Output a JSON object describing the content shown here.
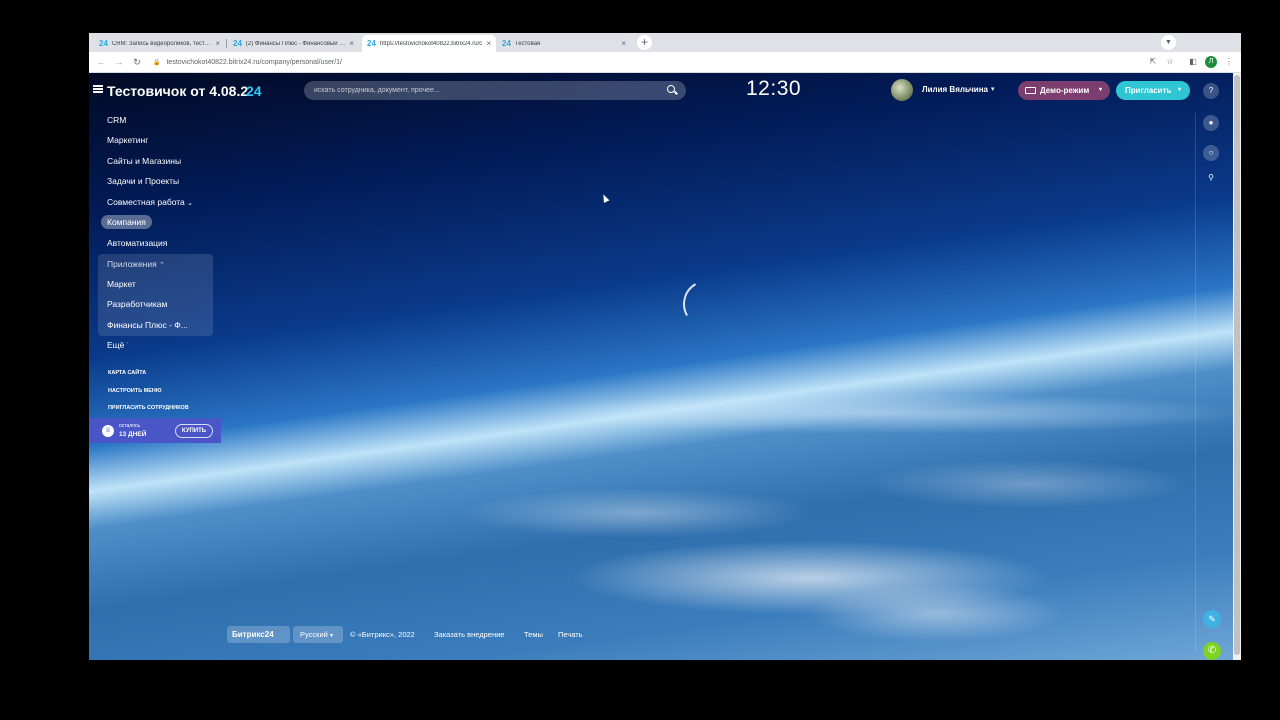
{
  "browser": {
    "tabs": [
      {
        "favicon": "24",
        "title": "CRM: Запись видеороликов, тестир"
      },
      {
        "favicon": "24",
        "title": "(2) Финансы Плюс - Финансовый и у"
      },
      {
        "favicon": "24",
        "title": "https://testovichokot40822.bitrix24.ru/c"
      },
      {
        "favicon": "24",
        "title": "Тестовая"
      }
    ],
    "url": "testovichokot40822.bitrix24.ru/company/personal/user/1/",
    "profile_initial": "Л",
    "new_tab": "+",
    "tab_close": "×"
  },
  "header": {
    "portal_title": "Тестовичок от 4.08.2",
    "logo_suffix": "24",
    "search_placeholder": "искать сотрудника, документ, прочее...",
    "clock": "12:30",
    "user_name": "Лилия Вяльчина",
    "demo_label": "Демо-режим",
    "invite_label": "Пригласить"
  },
  "menu": {
    "items": [
      {
        "label": "CRM"
      },
      {
        "label": "Маркетинг"
      },
      {
        "label": "Сайты и Магазины"
      },
      {
        "label": "Задачи и Проекты"
      },
      {
        "label": "Совместная работа"
      },
      {
        "label": "Компания"
      },
      {
        "label": "Автоматизация"
      },
      {
        "label": "Приложения"
      },
      {
        "label": "Маркет"
      },
      {
        "label": "Разработчикам"
      },
      {
        "label": "Финансы Плюс - Ф..."
      },
      {
        "label": "Ещё"
      }
    ],
    "links": [
      "Карта сайта",
      "Настроить меню",
      "Пригласить сотрудников"
    ],
    "trial": {
      "label": "осталось",
      "days": "13 ДНЕЙ",
      "buy": "КУПИТЬ"
    }
  },
  "footer": {
    "logo": "Битрикс24",
    "language": "Русский",
    "copyright": "© «Битрикс», 2022",
    "order": "Заказать внедрение",
    "themes": "Темы",
    "print": "Печать"
  },
  "colors": {
    "accent_logo": "#2fc7f7",
    "demo_button": "#7c3e6e",
    "invite_button": "#2fc6d3",
    "trial_banner": "#4a56c8",
    "phone_button": "#7ed321"
  },
  "icons": [
    "hamburger-icon",
    "search-icon",
    "bell-icon",
    "chat-icon",
    "gear-icon",
    "phone-icon",
    "notes-icon"
  ]
}
